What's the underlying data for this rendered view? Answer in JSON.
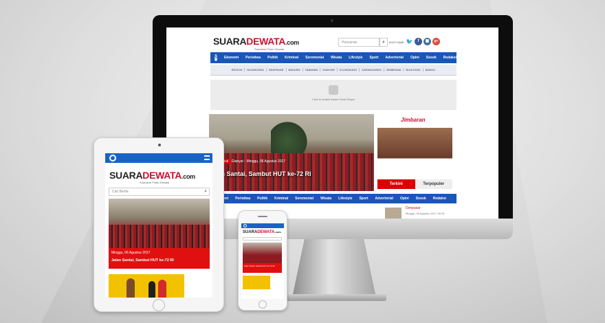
{
  "site": {
    "logo_suara": "SUARA",
    "logo_dewata": "DEWATA",
    "logo_com": ".com",
    "tagline": "Suarakan Pulau Dewata"
  },
  "desktop": {
    "search_placeholder": "Pencarian",
    "follow_label": "IKUTI KAMI",
    "nav": [
      "Ekonomi",
      "Peristiwa",
      "Politik",
      "Kriminal",
      "Seremonial",
      "Wisata",
      "Lifestyle",
      "Sport",
      "Advertorial",
      "Opini",
      "Sosok",
      "Redaksi"
    ],
    "subnav": [
      "REGION",
      "NUSANTARA",
      "DENPASAR",
      "BADUNG",
      "TABANAN",
      "GIANYAR",
      "KLUNGKUNG",
      "KARANGASEM",
      "JEMBRANA",
      "BULELENG",
      "BANGLI"
    ],
    "flash_text": "Click to enable Adobe Flash Player",
    "hero_category": "Seremonial",
    "hero_meta": "Gianyar - Minggu, 06 Agustus 2017",
    "hero_title": "Jalan Santai, Sambut HUT ke-72 RI",
    "ad_brand": "Jimbaran",
    "tab_terkini": "Terkini",
    "tab_terpopuler": "Terpopuler",
    "side_location": "Denpasar",
    "side_date": "Minggu, 06 Agustus 2017 18:18"
  },
  "tablet": {
    "search_placeholder": "Cari Berita",
    "caption_date": "Minggu, 06 Agustus 2017",
    "caption_title": "Jalan Santai, Sambut HUT ke-72 RI"
  },
  "colors": {
    "brand_red": "#c8102e",
    "nav_blue": "#1a56b8",
    "twitter": "#1da1f2",
    "facebook": "#3b5998",
    "instagram": "#3f729b",
    "google_plus": "#dd4b39"
  },
  "icons": [
    "search-icon",
    "twitter-icon",
    "facebook-icon",
    "instagram-icon",
    "google-plus-icon",
    "home-icon",
    "hamburger-menu-icon",
    "puzzle-icon"
  ]
}
